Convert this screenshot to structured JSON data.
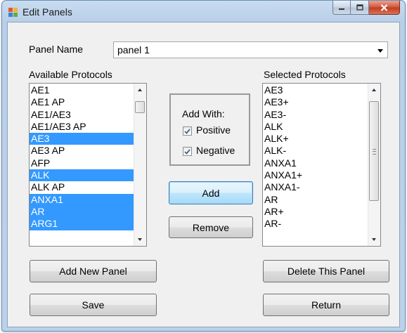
{
  "window": {
    "title": "Edit Panels"
  },
  "panel_name": {
    "label": "Panel Name",
    "value": "panel 1"
  },
  "available": {
    "label": "Available Protocols",
    "items": [
      {
        "text": "AE1",
        "selected": false
      },
      {
        "text": "AE1 AP",
        "selected": false
      },
      {
        "text": "AE1/AE3",
        "selected": false
      },
      {
        "text": "AE1/AE3 AP",
        "selected": false
      },
      {
        "text": "AE3",
        "selected": true
      },
      {
        "text": "AE3 AP",
        "selected": false
      },
      {
        "text": "AFP",
        "selected": false
      },
      {
        "text": "ALK",
        "selected": true
      },
      {
        "text": "ALK AP",
        "selected": false
      },
      {
        "text": "ANXA1",
        "selected": true
      },
      {
        "text": "AR",
        "selected": true
      },
      {
        "text": "ARG1",
        "selected": true
      }
    ]
  },
  "selected": {
    "label": "Selected Protocols",
    "items": [
      "AE3",
      "AE3+",
      "AE3-",
      "ALK",
      "ALK+",
      "ALK-",
      "ANXA1",
      "ANXA1+",
      "ANXA1-",
      "AR",
      "AR+",
      "AR-"
    ]
  },
  "add_with": {
    "label": "Add With:",
    "positive_label": "Positive",
    "positive_checked": true,
    "negative_label": "Negative",
    "negative_checked": true
  },
  "buttons": {
    "add": "Add",
    "remove": "Remove",
    "add_new_panel": "Add New Panel",
    "delete_this_panel": "Delete This Panel",
    "save": "Save",
    "return": "Return"
  },
  "colors": {
    "selection": "#3399ff",
    "window_frame": "#b8cfe8",
    "client_bg": "#f0f0f0"
  }
}
